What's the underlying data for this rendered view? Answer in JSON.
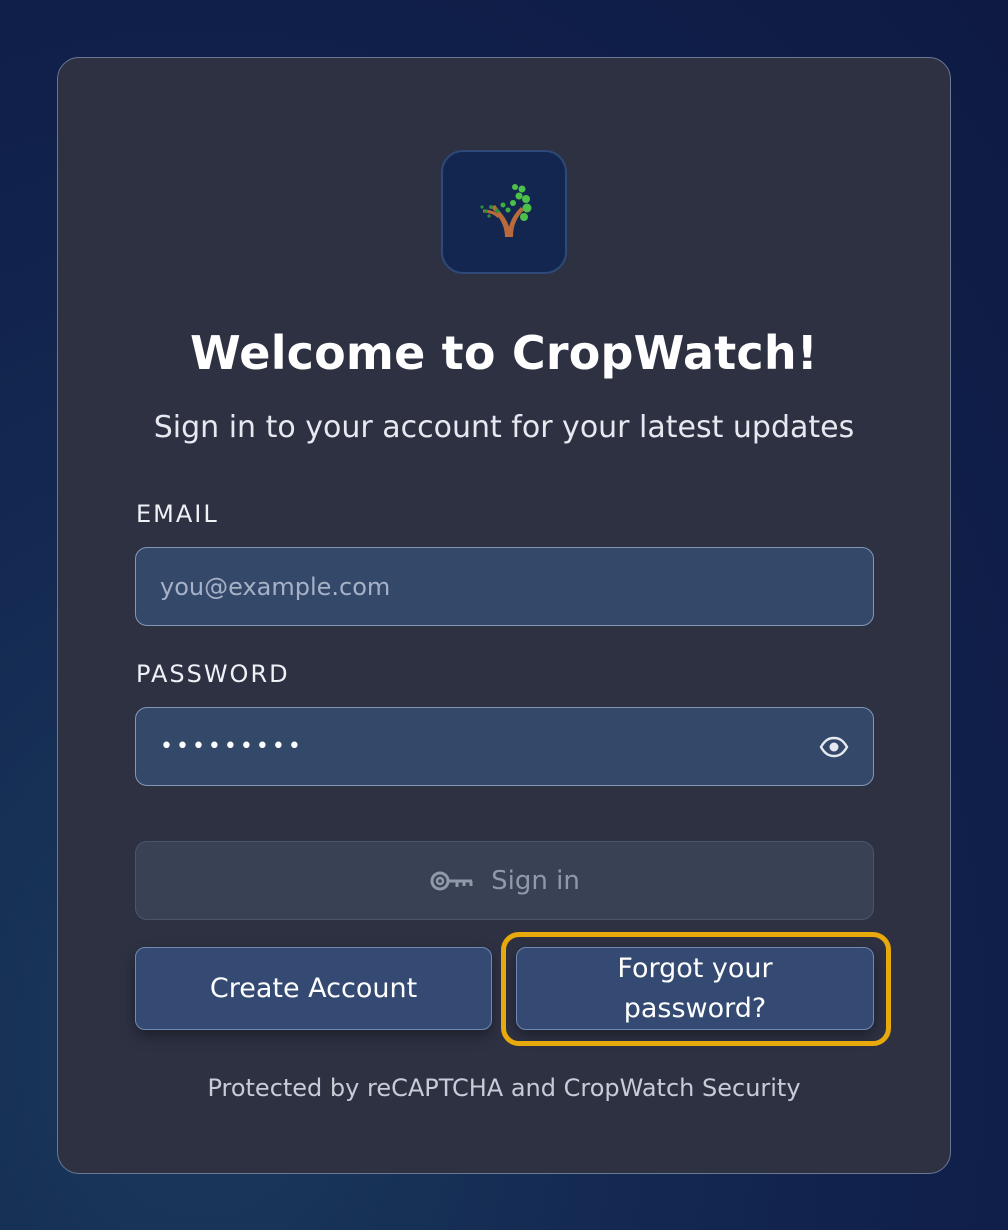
{
  "welcome": {
    "title": "Welcome to CropWatch!",
    "subtitle": "Sign in to your account for your latest updates"
  },
  "logo": {
    "icon": "cropwatch-tree-logo-icon"
  },
  "form": {
    "email_label": "EMAIL",
    "email_placeholder": "you@example.com",
    "email_value": "",
    "password_label": "PASSWORD",
    "password_value": "•••••••••",
    "password_toggle_icon": "eye-icon",
    "signin_label": "Sign in",
    "signin_icon": "key-icon"
  },
  "actions": {
    "create_account": "Create Account",
    "forgot_password": "Forgot your password?"
  },
  "footer": {
    "text": "Protected by reCAPTCHA and CropWatch Security"
  },
  "colors": {
    "card_bg": "#2d3142",
    "input_bg": "#34496a",
    "button_bg": "#344a72",
    "highlight": "#e8a90c"
  }
}
